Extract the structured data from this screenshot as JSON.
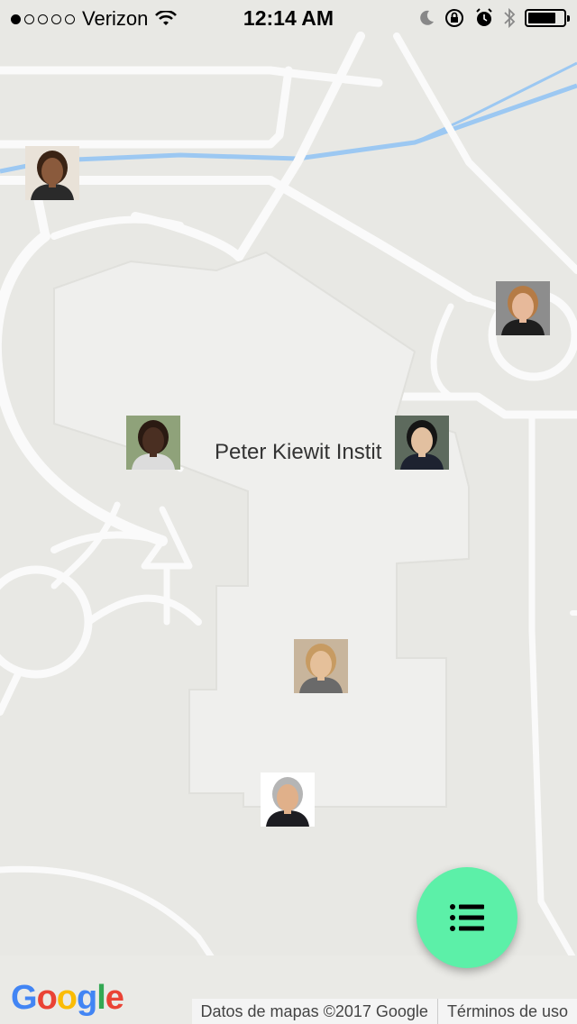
{
  "status_bar": {
    "carrier": "Verizon",
    "time": "12:14 AM",
    "signal_filled": 1,
    "signal_total": 5,
    "battery_level": 0.8
  },
  "map": {
    "place_label": "Peter Kiewit Instit",
    "markers": [
      {
        "name": "woman-curly-hair",
        "skin": "#8a5a3c",
        "hair": "#3a2314",
        "bg": "#e9e2d8",
        "shirt": "#2a2a2a"
      },
      {
        "name": "woman-blonde-business",
        "skin": "#e7b99a",
        "hair": "#b57b45",
        "bg": "#8d8d8d",
        "shirt": "#1e1e1e"
      },
      {
        "name": "man-dark-skin",
        "skin": "#4a2f22",
        "hair": "#2a1a12",
        "bg": "#8fa27a",
        "shirt": "#dcdcdc"
      },
      {
        "name": "man-glasses-suit",
        "skin": "#e2c0a0",
        "hair": "#151515",
        "bg": "#5d6a5d",
        "shirt": "#1d2230"
      },
      {
        "name": "woman-blonde-smile",
        "skin": "#e5c09a",
        "hair": "#c79b62",
        "bg": "#c8b59c",
        "shirt": "#6a6a6a"
      },
      {
        "name": "man-gray-hair-suit",
        "skin": "#e0b08a",
        "hair": "#b5b5b5",
        "bg": "#ffffff",
        "shirt": "#1d1d22"
      }
    ]
  },
  "fab": {
    "icon": "list-icon",
    "color": "#5cf0a8"
  },
  "footer": {
    "logo_letters": [
      "G",
      "o",
      "o",
      "g",
      "l",
      "e"
    ],
    "logo_colors": [
      "#4285F4",
      "#EA4335",
      "#FBBC05",
      "#4285F4",
      "#34A853",
      "#EA4335"
    ],
    "map_data": "Datos de mapas ©2017 Google",
    "terms": "Términos de uso"
  }
}
